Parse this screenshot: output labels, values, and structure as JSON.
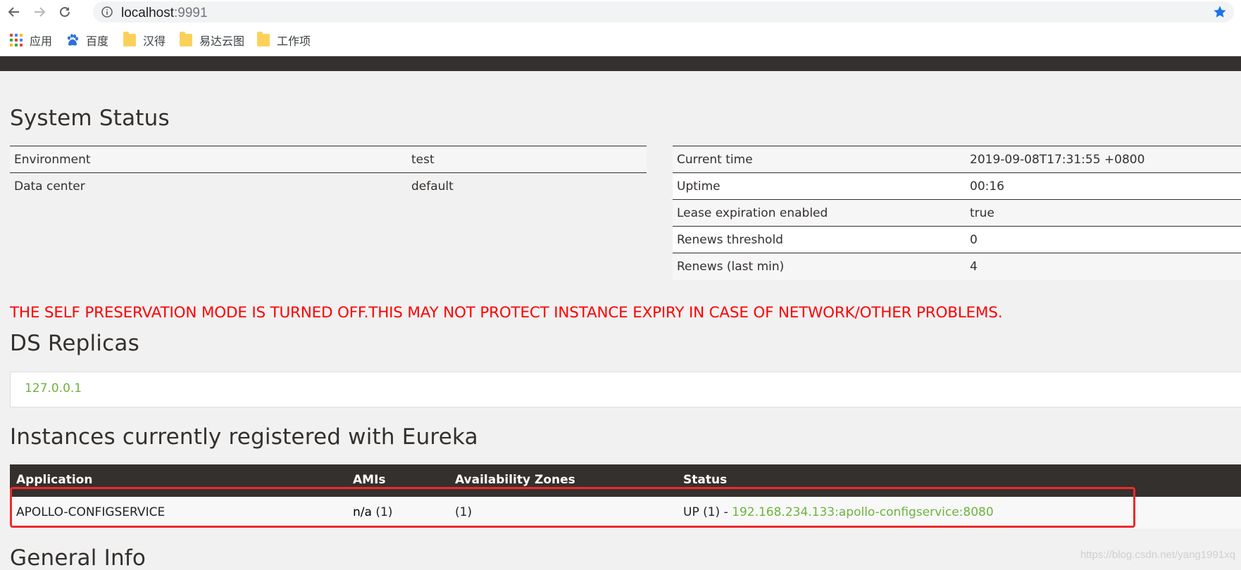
{
  "browser": {
    "url_host": "localhost",
    "url_port": ":9991",
    "bookmarks": [
      {
        "label": "应用",
        "icon": "apps-grid-icon"
      },
      {
        "label": "百度",
        "icon": "baidu-paw-icon"
      },
      {
        "label": "汉得",
        "icon": "folder-icon"
      },
      {
        "label": "易达云图",
        "icon": "folder-icon"
      },
      {
        "label": "工作项",
        "icon": "folder-icon"
      }
    ]
  },
  "system_status": {
    "title": "System Status",
    "left": [
      {
        "key": "Environment",
        "value": "test"
      },
      {
        "key": "Data center",
        "value": "default"
      }
    ],
    "right": [
      {
        "key": "Current time",
        "value": "2019-09-08T17:31:55 +0800"
      },
      {
        "key": "Uptime",
        "value": "00:16"
      },
      {
        "key": "Lease expiration enabled",
        "value": "true"
      },
      {
        "key": "Renews threshold",
        "value": "0"
      },
      {
        "key": "Renews (last min)",
        "value": "4"
      }
    ]
  },
  "warning": "THE SELF PRESERVATION MODE IS TURNED OFF.THIS MAY NOT PROTECT INSTANCE EXPIRY IN CASE OF NETWORK/OTHER PROBLEMS.",
  "ds_replicas": {
    "title": "DS Replicas",
    "items": [
      "127.0.0.1"
    ]
  },
  "instances": {
    "title": "Instances currently registered with Eureka",
    "columns": [
      "Application",
      "AMIs",
      "Availability Zones",
      "Status"
    ],
    "rows": [
      {
        "application": "APOLLO-CONFIGSERVICE",
        "amis_bold": "n/a",
        "amis_count": " (1)",
        "zones": "(1)",
        "status_prefix": "UP (1) - ",
        "status_link": "192.168.234.133:apollo-configservice:8080"
      }
    ]
  },
  "general_info": {
    "title": "General Info"
  },
  "watermark": "https://blog.csdn.net/yang1991xq",
  "colors": {
    "accent_green": "#6db33f",
    "header_dark": "#34302d",
    "warning_red": "#ff0000",
    "highlight_red": "#ee2a2a"
  }
}
